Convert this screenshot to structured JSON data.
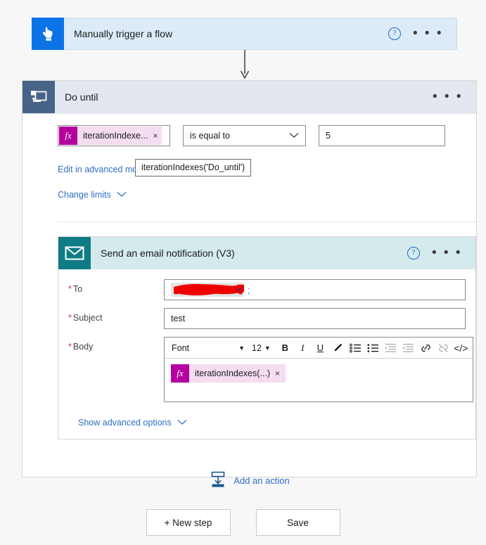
{
  "trigger": {
    "title": "Manually trigger a flow",
    "icon": "tap-hand-icon",
    "help_label": "?",
    "menu_label": "• • •"
  },
  "do_until": {
    "title": "Do until",
    "icon": "loop-icon",
    "menu_label": "• • •",
    "condition": {
      "token_text": "iterationIndexe...",
      "token_fx": "fx",
      "token_remove": "×",
      "operator": "is equal to",
      "operator_caret": "⌄",
      "value": "5"
    },
    "tooltip": "iterationIndexes('Do_until')",
    "advanced_link": "Edit in advanced mode",
    "limits_link": "Change limits",
    "limits_caret": "⌄"
  },
  "email_action": {
    "title": "Send an email notification (V3)",
    "icon": "envelope-icon",
    "help_label": "?",
    "menu_label": "• • •",
    "fields": {
      "to_label": "To",
      "to_separator": ";",
      "to_remove": "×",
      "subject_label": "Subject",
      "subject_value": "test",
      "body_label": "Body"
    },
    "editor": {
      "font_label": "Font",
      "font_caret": "▼",
      "size_value": "12",
      "size_caret": "▼",
      "bold": "B",
      "italic": "I",
      "underline": "U",
      "code": "</>",
      "buttons": [
        "bold-icon",
        "italic-icon",
        "underline-icon",
        "highlight-pen-icon",
        "numbered-list-icon",
        "bulleted-list-icon",
        "indent-icon",
        "outdent-icon",
        "link-icon",
        "unlink-icon",
        "code-view-icon"
      ],
      "body_token_text": "iterationIndexes(...)",
      "body_token_fx": "fx",
      "body_token_remove": "×"
    },
    "show_advanced": "Show advanced options",
    "show_advanced_caret": "⌄"
  },
  "add_action": {
    "label": "Add an action",
    "icon": "add-action-icon"
  },
  "footer": {
    "new_step": "+ New step",
    "save": "Save"
  },
  "colors": {
    "trigger_blue": "#0d74e7",
    "trigger_bg": "#ddebf9",
    "do_until_slate": "#486388",
    "do_until_bg": "#e3e7ef",
    "email_teal": "#0f7c85",
    "email_bg": "#d5eaec",
    "token_magenta": "#b4009e",
    "token_pink": "#f4ddf0",
    "link_blue": "#2d6fc6",
    "required_red": "#d13438",
    "page_bg": "#f7f7f7"
  }
}
